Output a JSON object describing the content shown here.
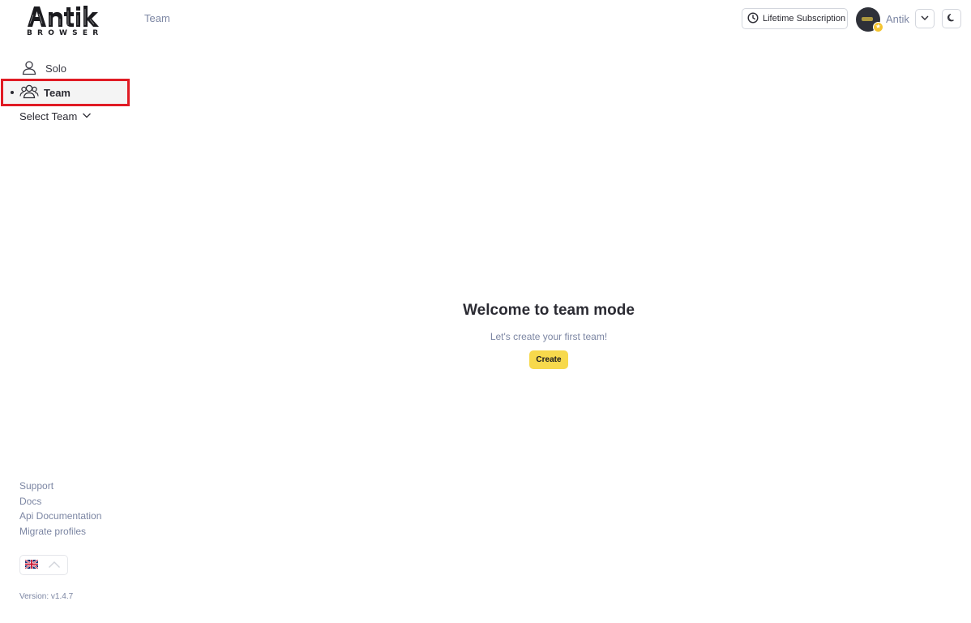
{
  "logo": {
    "brand": "Antik",
    "subtitle": "BROWSER"
  },
  "header": {
    "breadcrumb": "Team",
    "subscription_label": "Lifetime Subscription",
    "user_name": "Antik"
  },
  "sidebar": {
    "items": [
      {
        "label": "Solo",
        "icon": "user-icon",
        "active": false
      },
      {
        "label": "Team",
        "icon": "users-icon",
        "active": true
      }
    ],
    "select_team_label": "Select Team"
  },
  "main": {
    "title": "Welcome to team mode",
    "subtitle": "Let's create your first team!",
    "create_label": "Create"
  },
  "footer": {
    "links": [
      "Support",
      "Docs",
      "Api Documentation",
      "Migrate profiles"
    ],
    "language_flag": "uk-flag-icon",
    "version": "Version: v1.4.7"
  },
  "colors": {
    "accent_yellow": "#f7d94c",
    "highlight_red": "#e01b24",
    "muted_text": "#7c86a3"
  }
}
